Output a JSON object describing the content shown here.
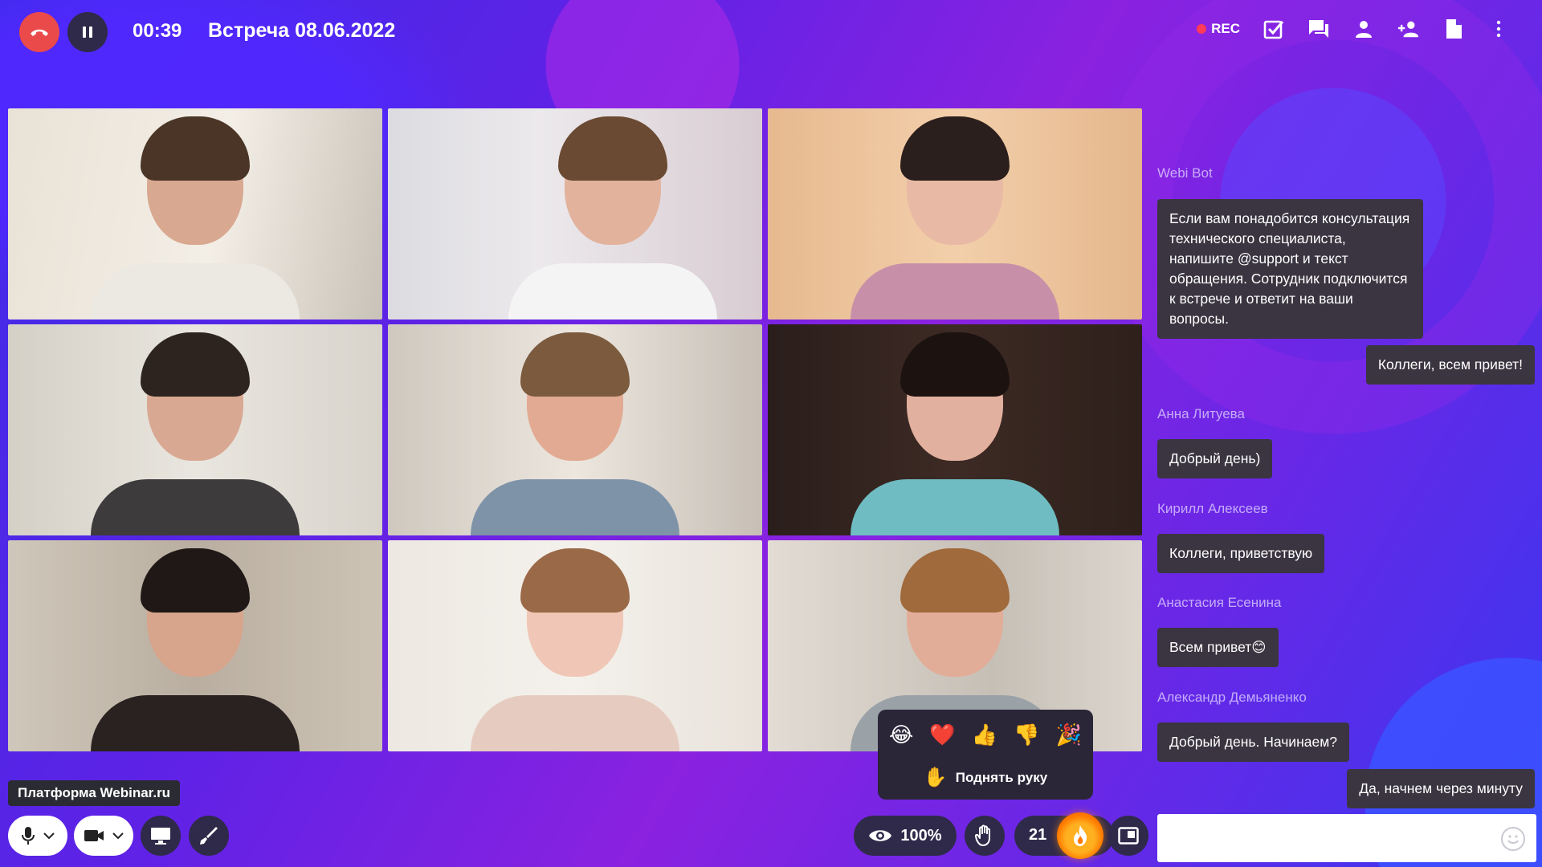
{
  "header": {
    "timer": "00:39",
    "title": "Встреча 08.06.2022",
    "rec_label": "REC"
  },
  "icons": {
    "end_call": "end-call-icon",
    "pause": "pause-icon",
    "poll": "poll-checkbox-icon",
    "chat": "chat-icon",
    "participants": "person-icon",
    "invite": "add-person-icon",
    "document": "document-icon",
    "more": "more-vertical-icon"
  },
  "colors": {
    "end_call": "#ea4a4a",
    "rec_dot": "#ff3a5a",
    "fire": "#ff7a00",
    "bubble": "#3a3540"
  },
  "chat": {
    "messages": [
      {
        "sender": "Webi Bot",
        "text": "Если вам понадобится консультация технического специалиста, напишите @support и текст обращения. Сотрудник подключится к встрече и ответит на ваши вопросы.",
        "own": false
      },
      {
        "sender": "",
        "text": "Коллеги, всем привет!",
        "own": true
      },
      {
        "sender": "Анна Литуева",
        "text": "Добрый день)",
        "own": false
      },
      {
        "sender": "Кирилл Алексеев",
        "text": "Коллеги, приветствую",
        "own": false
      },
      {
        "sender": "Анастасия Есенина",
        "text": "Всем привет😊",
        "own": false
      },
      {
        "sender": "Александр Демьяненко",
        "text": "Добрый день. Начинаем?",
        "own": false
      },
      {
        "sender": "",
        "text": "Да, начнем через минуту",
        "own": true
      }
    ],
    "input_value": ""
  },
  "bottom": {
    "platform_label": "Платформа Webinar.ru",
    "view_percent": "100%",
    "reaction_count": "21",
    "raise_hand_label": "Поднять руку",
    "reactions": [
      "😂",
      "❤️",
      "👍",
      "👎",
      "🎉"
    ]
  }
}
